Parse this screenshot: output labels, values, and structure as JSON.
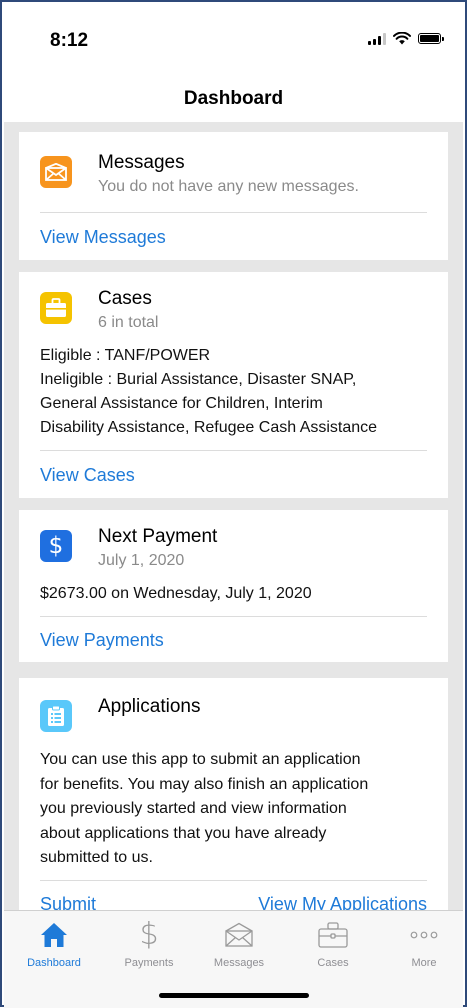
{
  "status_bar": {
    "time": "8:12"
  },
  "nav": {
    "title": "Dashboard"
  },
  "cards": {
    "messages": {
      "icon": "envelope-icon",
      "color": "#f7941d",
      "title": "Messages",
      "subtitle": "You do not have any new messages.",
      "link": "View Messages"
    },
    "cases": {
      "icon": "briefcase-icon",
      "color": "#f5c300",
      "title": "Cases",
      "subtitle": "6 in total",
      "body": [
        "Eligible : TANF/POWER",
        "Ineligible : Burial Assistance, Disaster SNAP,",
        "General Assistance for Children, Interim",
        "Disability Assistance, Refugee Cash Assistance"
      ],
      "link": "View Cases"
    },
    "payment": {
      "icon": "dollar-icon",
      "color": "#1f6fe0",
      "title": "Next Payment",
      "subtitle": "July 1, 2020",
      "body": "$2673.00 on Wednesday, July 1, 2020",
      "link": "View Payments"
    },
    "applications": {
      "icon": "clipboard-icon",
      "color": "#5ac8fa",
      "title": "Applications",
      "body": [
        "You can use this app to submit an application",
        "for benefits. You may also finish an application",
        "you previously started and view information",
        "about applications that you have already",
        "submitted to us."
      ],
      "link_submit": "Submit",
      "link_view": "View My Applications"
    }
  },
  "tabs": [
    {
      "label": "Dashboard",
      "icon": "home-icon",
      "active": true
    },
    {
      "label": "Payments",
      "icon": "dollar-icon",
      "active": false
    },
    {
      "label": "Messages",
      "icon": "envelope-icon",
      "active": false
    },
    {
      "label": "Cases",
      "icon": "briefcase-icon",
      "active": false
    },
    {
      "label": "More",
      "icon": "ellipsis-icon",
      "active": false
    }
  ],
  "colors": {
    "accent": "#1e7ad8",
    "background": "#e6e6e6"
  }
}
